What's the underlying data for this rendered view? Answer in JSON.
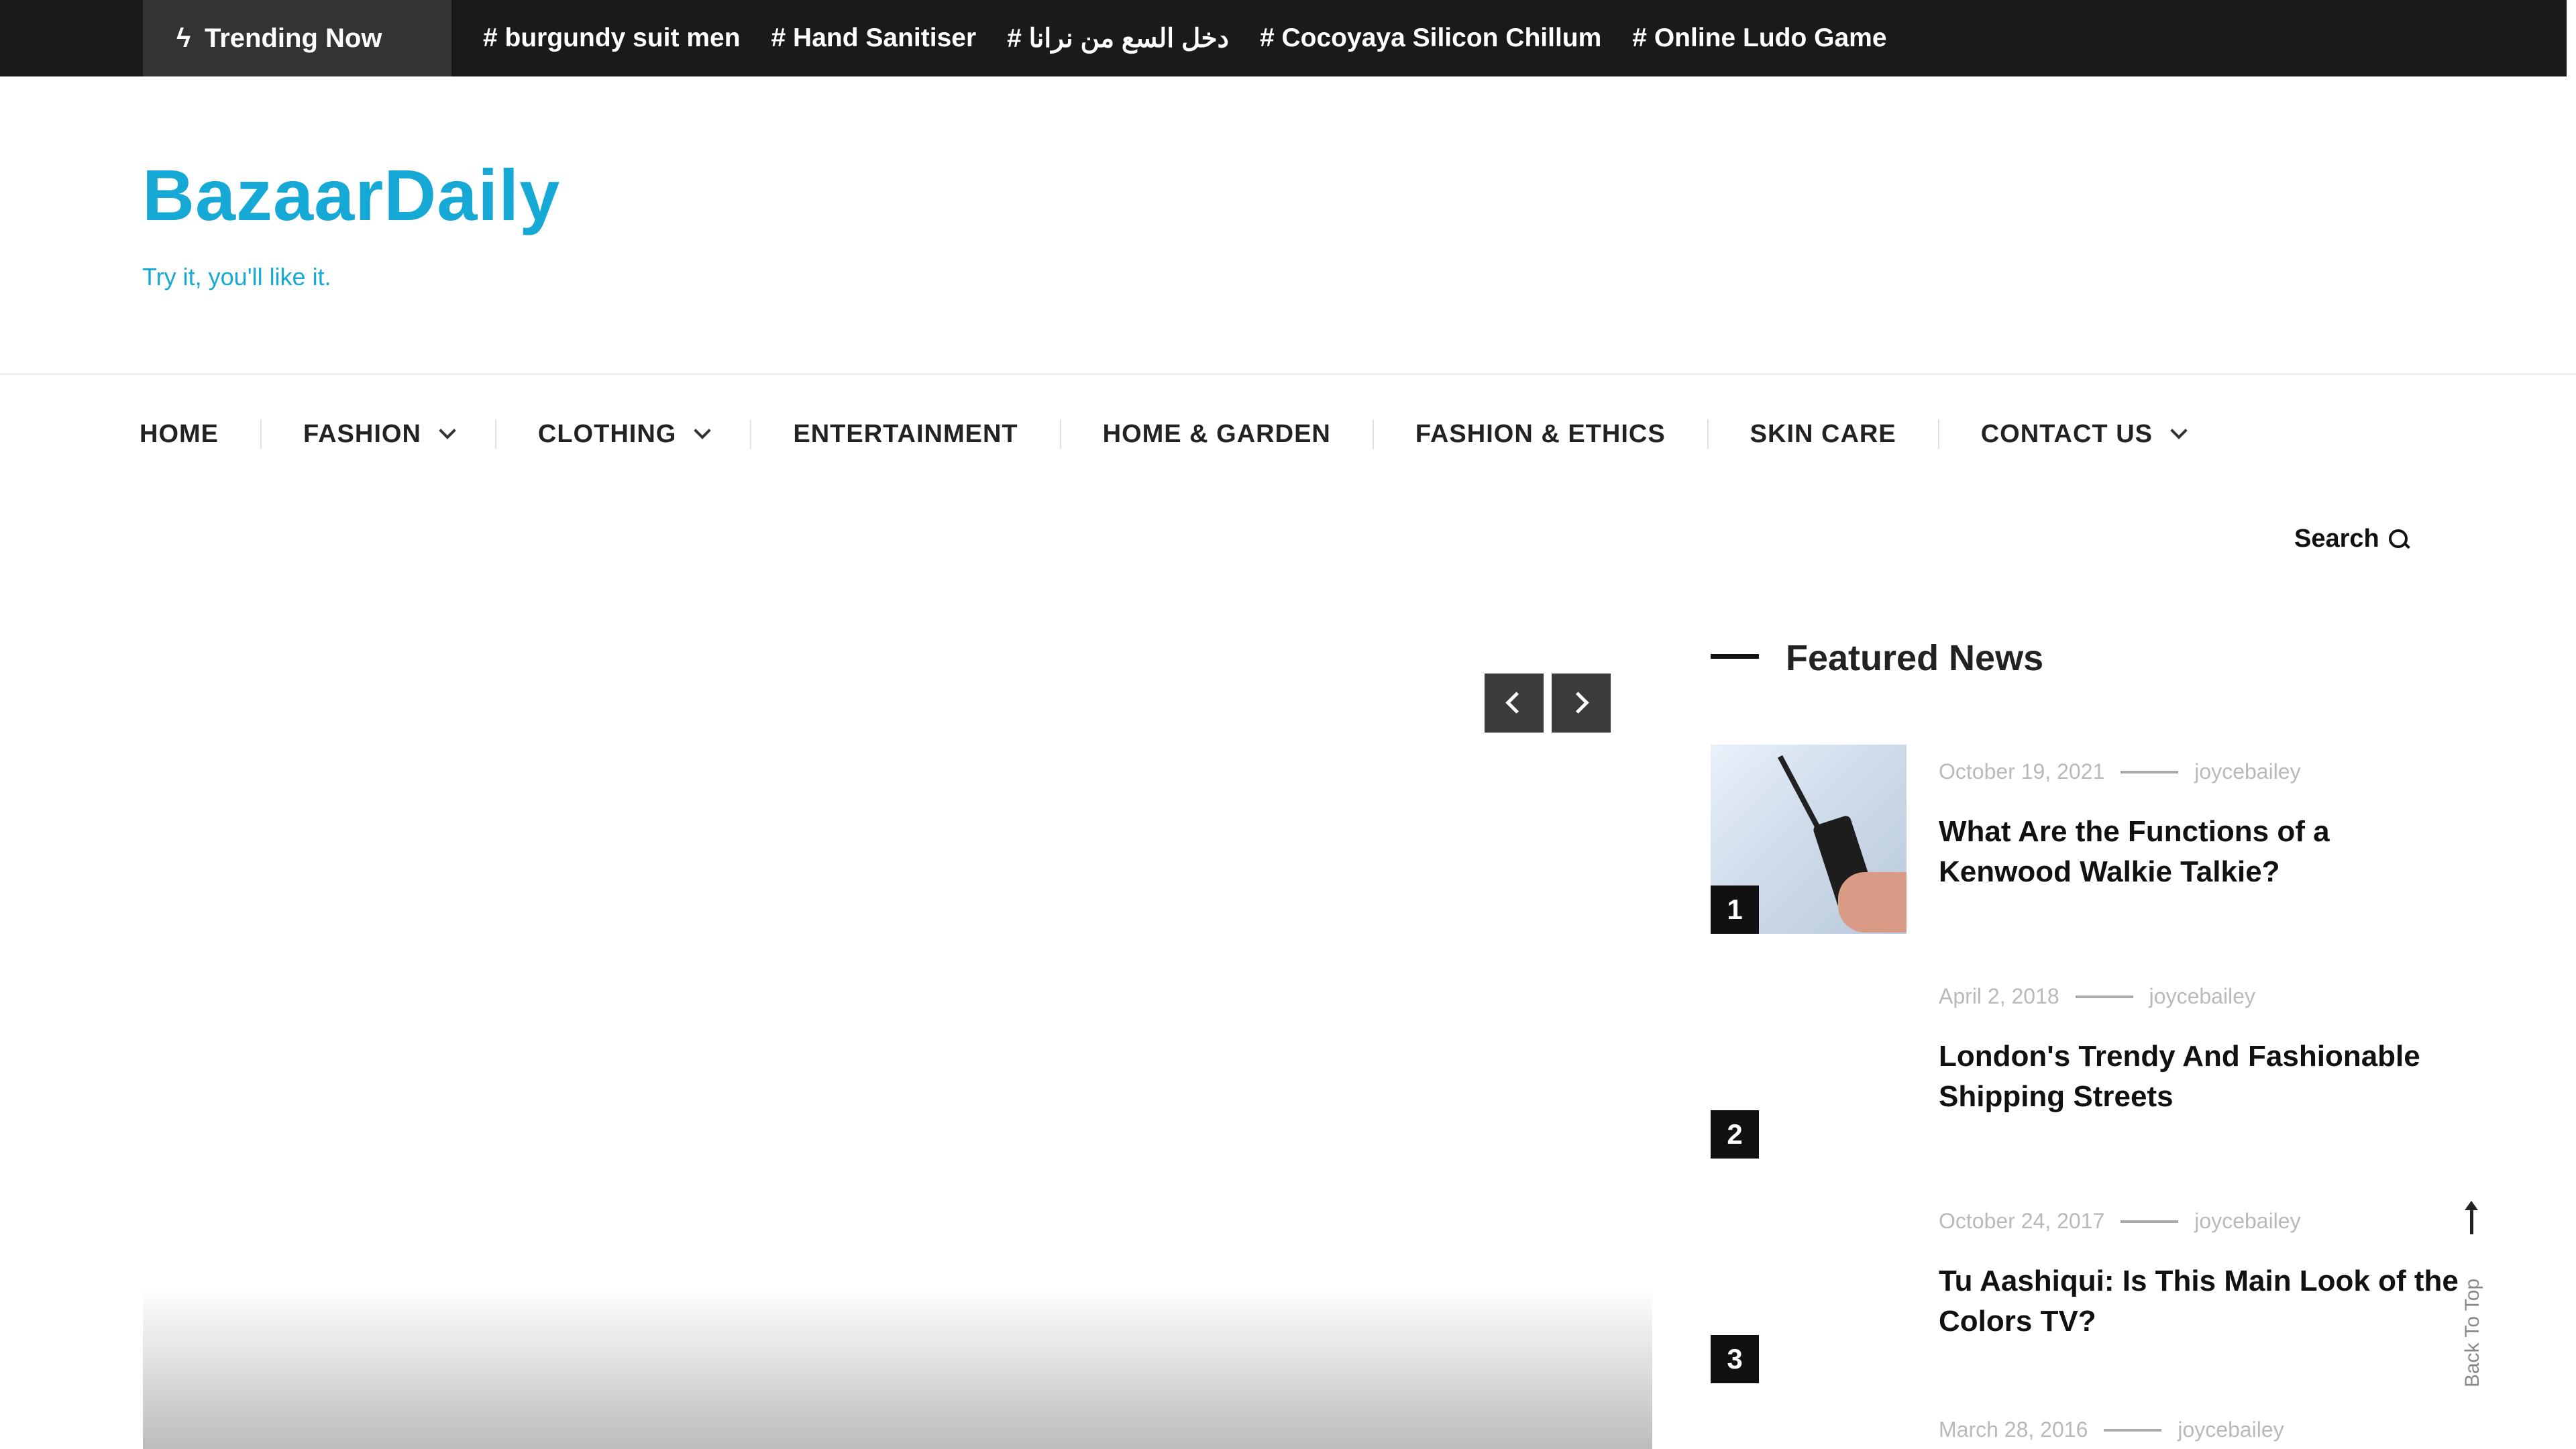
{
  "trending": {
    "label": "Trending Now",
    "tags": [
      "# burgundy suit men",
      "# Hand Sanitiser",
      "# دخل السع من نرانا",
      "# Cocoyaya Silicon Chillum",
      "# Online Ludo Game"
    ]
  },
  "site": {
    "name": "BazaarDaily",
    "tagline": "Try it, you'll like it."
  },
  "nav": {
    "items": [
      {
        "label": "HOME",
        "dropdown": false
      },
      {
        "label": "FASHION",
        "dropdown": true
      },
      {
        "label": "CLOTHING",
        "dropdown": true
      },
      {
        "label": "ENTERTAINMENT",
        "dropdown": false
      },
      {
        "label": "HOME & GARDEN",
        "dropdown": false
      },
      {
        "label": "FASHION & ETHICS",
        "dropdown": false
      },
      {
        "label": "SKIN CARE",
        "dropdown": false
      },
      {
        "label": "CONTACT US",
        "dropdown": true
      }
    ]
  },
  "search": {
    "label": "Search"
  },
  "featured": {
    "title": "Featured News",
    "items": [
      {
        "number": "1",
        "date": "October 19, 2021",
        "author": "joycebailey",
        "title": "What Are the Functions of a Kenwood Walkie Talkie?"
      },
      {
        "number": "2",
        "date": "April 2, 2018",
        "author": "joycebailey",
        "title": "London's Trendy And Fashionable Shipping Streets"
      },
      {
        "number": "3",
        "date": "October 24, 2017",
        "author": "joycebailey",
        "title": "Tu Aashiqui: Is This Main Look of the Colors TV?"
      },
      {
        "date": "March 28, 2016",
        "author": "joycebailey"
      }
    ]
  },
  "back_to_top": {
    "label": "Back To Top"
  },
  "colors": {
    "brand": "#16a9d6",
    "topbar": "#1a1a1a"
  }
}
